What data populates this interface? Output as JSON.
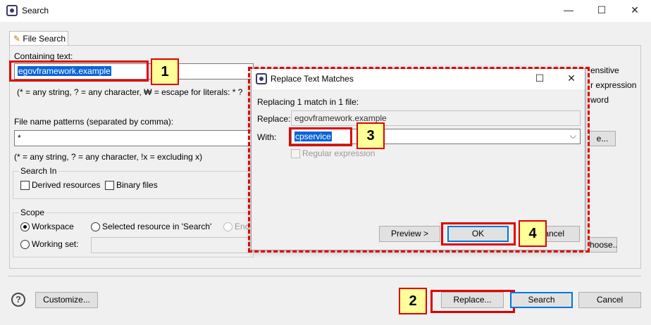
{
  "window": {
    "title": "Search",
    "minimize_glyph": "—",
    "maximize_glyph": "☐",
    "close_glyph": "✕"
  },
  "tab": {
    "label": "File Search",
    "icon": "file-search-icon"
  },
  "containing": {
    "label": "Containing text:",
    "value": "egovframework.example",
    "hint": "(* = any string, ? = any character, ₩ = escape for literals: * ?"
  },
  "options_partial": {
    "case_sensitive": "ensitive",
    "regular_expression": "r expression",
    "whole_word": "word"
  },
  "filename": {
    "label": "File name patterns (separated by comma):",
    "value": "*",
    "hint": "(* = any string, ? = any character, !x = excluding x)",
    "choose_partial": "e..."
  },
  "search_in": {
    "title": "Search In",
    "derived": "Derived resources",
    "binary": "Binary files"
  },
  "scope": {
    "title": "Scope",
    "workspace": "Workspace",
    "selected": "Selected resource in 'Search'",
    "enclosing_partial": "Enc",
    "working_set": "Working set:",
    "choose_partial": "hoose..."
  },
  "bottom": {
    "help_glyph": "?",
    "customize": "Customize...",
    "replace": "Replace...",
    "search": "Search",
    "cancel": "Cancel"
  },
  "dialog": {
    "title": "Replace Text Matches",
    "maximize_glyph": "☐",
    "close_glyph": "✕",
    "info": "Replacing 1 match in 1 file:",
    "replace_label": "Replace:",
    "replace_value": "egovframework.example",
    "with_label": "With:",
    "with_value": "cpservice",
    "regex": "Regular expression",
    "preview": "Preview >",
    "ok": "OK",
    "cancel_partial": "ancel",
    "dropdown_glyph": "⌵"
  },
  "annotations": [
    "1",
    "2",
    "3",
    "4"
  ],
  "colors": {
    "highlight": "#e00000",
    "badge": "#ffff99",
    "selection": "#0a64d6"
  }
}
